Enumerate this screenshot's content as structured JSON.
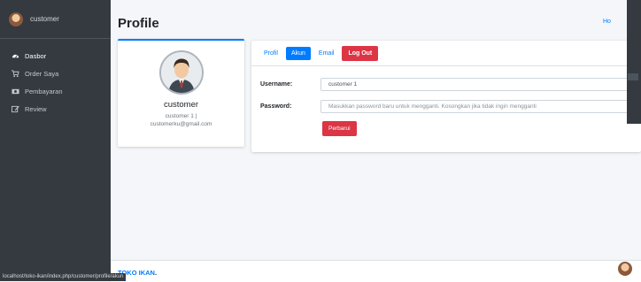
{
  "sidebar": {
    "user_name": "customer",
    "items": [
      {
        "label": "Dasbor",
        "icon": "tachometer-icon"
      },
      {
        "label": "Order Saya",
        "icon": "cart-icon"
      },
      {
        "label": "Pembayaran",
        "icon": "money-icon"
      },
      {
        "label": "Review",
        "icon": "edit-icon"
      }
    ]
  },
  "header": {
    "title": "Profile",
    "breadcrumb": "Ho"
  },
  "profile_card": {
    "name": "customer",
    "line1": "customer 1 |",
    "line2": "customerku@gmail.com"
  },
  "tabs": [
    {
      "label": "Profil"
    },
    {
      "label": "Akun"
    },
    {
      "label": "Email"
    },
    {
      "label": "Log Out"
    }
  ],
  "form": {
    "username_label": "Username:",
    "username_value": "customer 1",
    "password_label": "Password:",
    "password_placeholder": "Masukkan password baru untuk mengganti. Kosongkan jika tidak ingin mengganti",
    "submit_label": "Perbarui"
  },
  "footer": {
    "brand": "TOKO IKAN",
    "brand_suffix": "."
  },
  "status_url": "localhost/toko-ikan/index.php/customer/profile/akun",
  "colors": {
    "sidebar_bg": "#343a40",
    "primary": "#007bff",
    "danger": "#dc3545"
  }
}
